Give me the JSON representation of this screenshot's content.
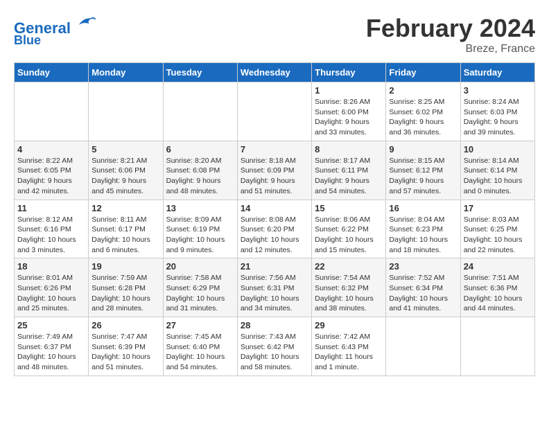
{
  "header": {
    "logo_line1": "General",
    "logo_line2": "Blue",
    "month": "February 2024",
    "location": "Breze, France"
  },
  "days_of_week": [
    "Sunday",
    "Monday",
    "Tuesday",
    "Wednesday",
    "Thursday",
    "Friday",
    "Saturday"
  ],
  "weeks": [
    [
      {
        "day": "",
        "info": ""
      },
      {
        "day": "",
        "info": ""
      },
      {
        "day": "",
        "info": ""
      },
      {
        "day": "",
        "info": ""
      },
      {
        "day": "1",
        "info": "Sunrise: 8:26 AM\nSunset: 6:00 PM\nDaylight: 9 hours\nand 33 minutes."
      },
      {
        "day": "2",
        "info": "Sunrise: 8:25 AM\nSunset: 6:02 PM\nDaylight: 9 hours\nand 36 minutes."
      },
      {
        "day": "3",
        "info": "Sunrise: 8:24 AM\nSunset: 6:03 PM\nDaylight: 9 hours\nand 39 minutes."
      }
    ],
    [
      {
        "day": "4",
        "info": "Sunrise: 8:22 AM\nSunset: 6:05 PM\nDaylight: 9 hours\nand 42 minutes."
      },
      {
        "day": "5",
        "info": "Sunrise: 8:21 AM\nSunset: 6:06 PM\nDaylight: 9 hours\nand 45 minutes."
      },
      {
        "day": "6",
        "info": "Sunrise: 8:20 AM\nSunset: 6:08 PM\nDaylight: 9 hours\nand 48 minutes."
      },
      {
        "day": "7",
        "info": "Sunrise: 8:18 AM\nSunset: 6:09 PM\nDaylight: 9 hours\nand 51 minutes."
      },
      {
        "day": "8",
        "info": "Sunrise: 8:17 AM\nSunset: 6:11 PM\nDaylight: 9 hours\nand 54 minutes."
      },
      {
        "day": "9",
        "info": "Sunrise: 8:15 AM\nSunset: 6:12 PM\nDaylight: 9 hours\nand 57 minutes."
      },
      {
        "day": "10",
        "info": "Sunrise: 8:14 AM\nSunset: 6:14 PM\nDaylight: 10 hours\nand 0 minutes."
      }
    ],
    [
      {
        "day": "11",
        "info": "Sunrise: 8:12 AM\nSunset: 6:16 PM\nDaylight: 10 hours\nand 3 minutes."
      },
      {
        "day": "12",
        "info": "Sunrise: 8:11 AM\nSunset: 6:17 PM\nDaylight: 10 hours\nand 6 minutes."
      },
      {
        "day": "13",
        "info": "Sunrise: 8:09 AM\nSunset: 6:19 PM\nDaylight: 10 hours\nand 9 minutes."
      },
      {
        "day": "14",
        "info": "Sunrise: 8:08 AM\nSunset: 6:20 PM\nDaylight: 10 hours\nand 12 minutes."
      },
      {
        "day": "15",
        "info": "Sunrise: 8:06 AM\nSunset: 6:22 PM\nDaylight: 10 hours\nand 15 minutes."
      },
      {
        "day": "16",
        "info": "Sunrise: 8:04 AM\nSunset: 6:23 PM\nDaylight: 10 hours\nand 18 minutes."
      },
      {
        "day": "17",
        "info": "Sunrise: 8:03 AM\nSunset: 6:25 PM\nDaylight: 10 hours\nand 22 minutes."
      }
    ],
    [
      {
        "day": "18",
        "info": "Sunrise: 8:01 AM\nSunset: 6:26 PM\nDaylight: 10 hours\nand 25 minutes."
      },
      {
        "day": "19",
        "info": "Sunrise: 7:59 AM\nSunset: 6:28 PM\nDaylight: 10 hours\nand 28 minutes."
      },
      {
        "day": "20",
        "info": "Sunrise: 7:58 AM\nSunset: 6:29 PM\nDaylight: 10 hours\nand 31 minutes."
      },
      {
        "day": "21",
        "info": "Sunrise: 7:56 AM\nSunset: 6:31 PM\nDaylight: 10 hours\nand 34 minutes."
      },
      {
        "day": "22",
        "info": "Sunrise: 7:54 AM\nSunset: 6:32 PM\nDaylight: 10 hours\nand 38 minutes."
      },
      {
        "day": "23",
        "info": "Sunrise: 7:52 AM\nSunset: 6:34 PM\nDaylight: 10 hours\nand 41 minutes."
      },
      {
        "day": "24",
        "info": "Sunrise: 7:51 AM\nSunset: 6:36 PM\nDaylight: 10 hours\nand 44 minutes."
      }
    ],
    [
      {
        "day": "25",
        "info": "Sunrise: 7:49 AM\nSunset: 6:37 PM\nDaylight: 10 hours\nand 48 minutes."
      },
      {
        "day": "26",
        "info": "Sunrise: 7:47 AM\nSunset: 6:39 PM\nDaylight: 10 hours\nand 51 minutes."
      },
      {
        "day": "27",
        "info": "Sunrise: 7:45 AM\nSunset: 6:40 PM\nDaylight: 10 hours\nand 54 minutes."
      },
      {
        "day": "28",
        "info": "Sunrise: 7:43 AM\nSunset: 6:42 PM\nDaylight: 10 hours\nand 58 minutes."
      },
      {
        "day": "29",
        "info": "Sunrise: 7:42 AM\nSunset: 6:43 PM\nDaylight: 11 hours\nand 1 minute."
      },
      {
        "day": "",
        "info": ""
      },
      {
        "day": "",
        "info": ""
      }
    ]
  ]
}
